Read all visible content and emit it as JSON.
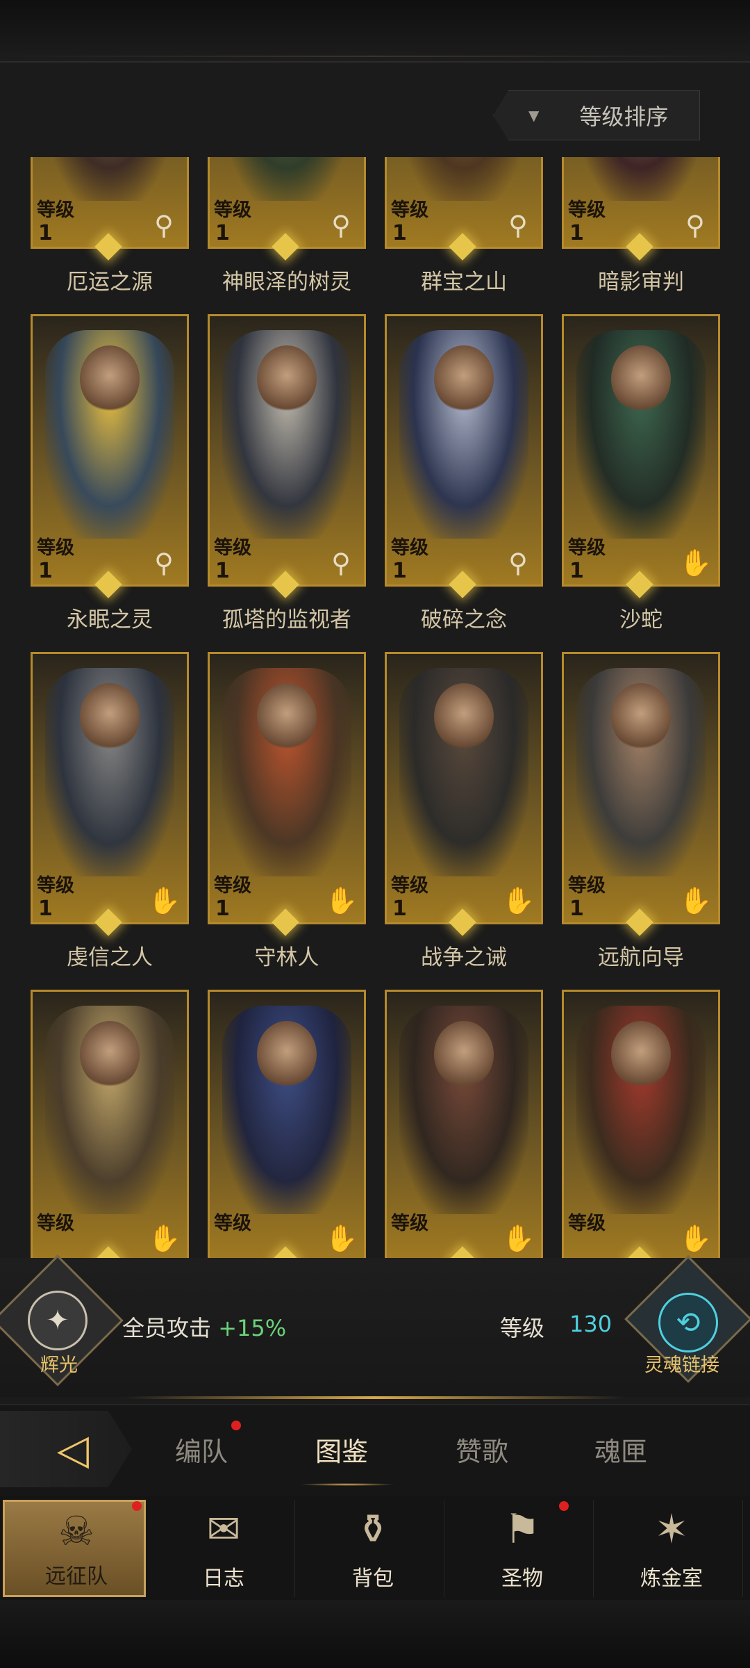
{
  "sort": {
    "label": "等级排序"
  },
  "level_label": "等级",
  "cards": [
    {
      "name": "厄运之源",
      "level": "1",
      "type": "wand",
      "c1": "#b58a70",
      "c2": "#3b2a25"
    },
    {
      "name": "神眼泽的树灵",
      "level": "1",
      "type": "wand",
      "c1": "#6a8d6a",
      "c2": "#2c3b2a"
    },
    {
      "name": "群宝之山",
      "level": "1",
      "type": "wand",
      "c1": "#b59050",
      "c2": "#4b3420"
    },
    {
      "name": "暗影审判",
      "level": "1",
      "type": "wand",
      "c1": "#c0906e",
      "c2": "#3a2226"
    },
    {
      "name": "永眠之灵",
      "level": "1",
      "type": "wand",
      "c1": "#f2c640",
      "c2": "#35495e"
    },
    {
      "name": "孤塔的监视者",
      "level": "1",
      "type": "wand",
      "c1": "#c7c1b5",
      "c2": "#2f3440"
    },
    {
      "name": "破碎之念",
      "level": "1",
      "type": "wand",
      "c1": "#b8c0d6",
      "c2": "#2a3352"
    },
    {
      "name": "沙蛇",
      "level": "1",
      "type": "hand",
      "c1": "#3d6a52",
      "c2": "#1f2b26"
    },
    {
      "name": "虔信之人",
      "level": "1",
      "type": "hand",
      "c1": "#8a8a8a",
      "c2": "#2c3340"
    },
    {
      "name": "守林人",
      "level": "1",
      "type": "hand",
      "c1": "#c2562f",
      "c2": "#4a3525"
    },
    {
      "name": "战争之诫",
      "level": "1",
      "type": "hand",
      "c1": "#5a4a3e",
      "c2": "#2a2a2a"
    },
    {
      "name": "远航向导",
      "level": "1",
      "type": "hand",
      "c1": "#a8856a",
      "c2": "#3b3b3b"
    },
    {
      "name": "",
      "level": "",
      "type": "hand",
      "c1": "#c9ad6e",
      "c2": "#4a3d2c"
    },
    {
      "name": "",
      "level": "",
      "type": "hand",
      "c1": "#3d4f8a",
      "c2": "#1e2340"
    },
    {
      "name": "",
      "level": "",
      "type": "hand",
      "c1": "#7a4a3a",
      "c2": "#2e2520"
    },
    {
      "name": "",
      "level": "",
      "type": "hand",
      "c1": "#a83a2e",
      "c2": "#3a2a1e"
    }
  ],
  "bonus": {
    "left_label": "辉光",
    "attack_text": "全员攻击",
    "attack_value": "+15%",
    "level_text": "等级",
    "level_value": "130",
    "right_label": "灵魂链接"
  },
  "tabs": [
    {
      "label": "编队",
      "badge": true
    },
    {
      "label": "图鉴",
      "badge": false,
      "active": true
    },
    {
      "label": "赞歌",
      "badge": false
    },
    {
      "label": "魂匣",
      "badge": false
    }
  ],
  "nav": [
    {
      "label": "远征队",
      "icon": "helmet-icon",
      "active": true,
      "badge": true
    },
    {
      "label": "日志",
      "icon": "journal-icon",
      "active": false,
      "badge": false
    },
    {
      "label": "背包",
      "icon": "backpack-icon",
      "active": false,
      "badge": false
    },
    {
      "label": "圣物",
      "icon": "relic-icon",
      "active": false,
      "badge": true
    },
    {
      "label": "炼金室",
      "icon": "alchemy-icon",
      "active": false,
      "badge": false
    }
  ],
  "colors": {
    "accent_gold": "#b68a2c",
    "cyan": "#4fd0e0",
    "green": "#6bd27a",
    "badge_red": "#e02020"
  }
}
